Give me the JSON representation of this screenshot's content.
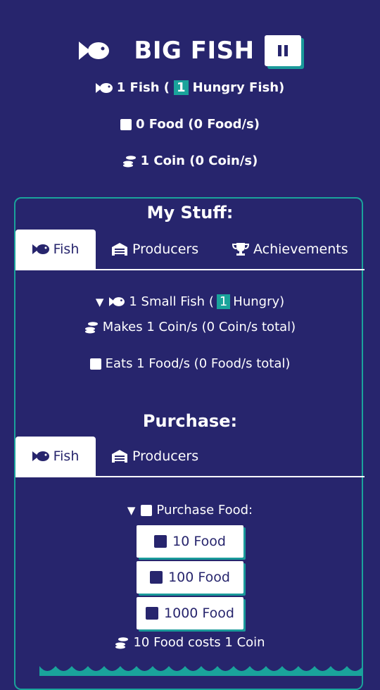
{
  "header": {
    "title": "BIG FISH"
  },
  "stats": {
    "fish_count": "1 Fish (",
    "hungry_count": "1",
    "hungry_label": "Hungry Fish)",
    "food": "0 Food (0 Food/s)",
    "coin": "1 Coin (0 Coin/s)"
  },
  "stuff": {
    "title": "My Stuff:",
    "tabs": [
      {
        "label": "Fish"
      },
      {
        "label": "Producers"
      },
      {
        "label": "Achievements"
      }
    ],
    "fish_entry": {
      "toggle": "▼",
      "name": "1 Small Fish (",
      "hungry": "1",
      "hungry_label": "Hungry)",
      "makes": "Makes 1 Coin/s (0 Coin/s total)",
      "eats": "Eats 1 Food/s (0 Food/s total)"
    }
  },
  "purchase": {
    "title": "Purchase:",
    "tabs": [
      {
        "label": "Fish"
      },
      {
        "label": "Producers"
      }
    ],
    "section_toggle": "▼",
    "section_label": "Purchase Food:",
    "buttons": [
      {
        "label": "10 Food"
      },
      {
        "label": "100 Food"
      },
      {
        "label": "1000 Food"
      }
    ],
    "cost_note": "10 Food costs 1 Coin"
  },
  "colors": {
    "background": "#27256d",
    "accent": "#1aa39b",
    "text": "#ffffff"
  }
}
